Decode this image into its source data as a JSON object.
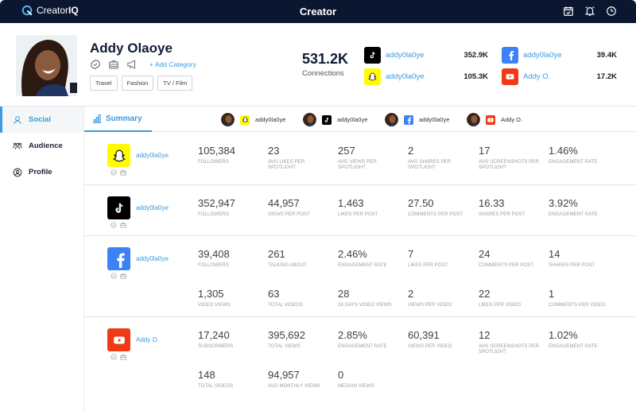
{
  "topbar": {
    "brand_prefix": "Creator",
    "brand_suffix": "IQ",
    "title": "Creator",
    "icons": [
      "calendar-check-icon",
      "bell-icon",
      "clock-icon"
    ]
  },
  "profile": {
    "name": "Addy Olaoye",
    "add_category": "+ Add Category",
    "tags": [
      "Travel",
      "Fashion",
      "TV / Film"
    ],
    "connections_total": "531.2K",
    "connections_label": "Connections",
    "accounts": [
      {
        "platform": "tiktok",
        "handle": "addy0la0ye",
        "count": "352.9K"
      },
      {
        "platform": "snapchat",
        "handle": "addy0la0ye",
        "count": "105.3K"
      },
      {
        "platform": "facebook",
        "handle": "addy0la0ye",
        "count": "39.4K"
      },
      {
        "platform": "youtube",
        "handle": "Addy O.",
        "count": "17.2K"
      }
    ]
  },
  "colors": {
    "accent": "#3a9be0",
    "navbar": "#0b1630",
    "snapchat": "#fffc00",
    "tiktok": "#000000",
    "facebook": "#3b82f6",
    "youtube": "#f03a17"
  },
  "sidebar": {
    "items": [
      {
        "label": "Social",
        "active": true
      },
      {
        "label": "Audience",
        "active": false
      },
      {
        "label": "Profile",
        "active": false
      }
    ]
  },
  "tabs": {
    "summary": "Summary",
    "accounts": [
      {
        "platform": "snapchat",
        "handle": "addy0la0ye"
      },
      {
        "platform": "tiktok",
        "handle": "addy0la0ye"
      },
      {
        "platform": "facebook",
        "handle": "addy0la0ye"
      },
      {
        "platform": "youtube",
        "handle": "Addy O."
      }
    ]
  },
  "rows": [
    {
      "platform": "snapchat",
      "handle": "addy0la0ye",
      "stats": [
        [
          {
            "value": "105,384",
            "label": "Followers"
          },
          {
            "value": "23",
            "label": "Avg likes per spotlight"
          },
          {
            "value": "257",
            "label": "Avg views per spotlight"
          },
          {
            "value": "2",
            "label": "Avg shares per spotlight"
          },
          {
            "value": "17",
            "label": "Avg screenshots per spotlight"
          },
          {
            "value": "1.46%",
            "label": "Engagement rate"
          }
        ]
      ]
    },
    {
      "platform": "tiktok",
      "handle": "addy0la0ye",
      "stats": [
        [
          {
            "value": "352,947",
            "label": "Followers"
          },
          {
            "value": "44,957",
            "label": "Views per post"
          },
          {
            "value": "1,463",
            "label": "Likes per post"
          },
          {
            "value": "27.50",
            "label": "Comments per post"
          },
          {
            "value": "16.33",
            "label": "Shares per post"
          },
          {
            "value": "3.92%",
            "label": "Engagement rate"
          }
        ]
      ]
    },
    {
      "platform": "facebook",
      "handle": "addy0la0ye",
      "stats": [
        [
          {
            "value": "39,408",
            "label": "Followers"
          },
          {
            "value": "261",
            "label": "Talking about"
          },
          {
            "value": "2.46%",
            "label": "Engagement rate"
          },
          {
            "value": "7",
            "label": "Likes per post"
          },
          {
            "value": "24",
            "label": "Comments per post"
          },
          {
            "value": "14",
            "label": "Shares per post"
          }
        ],
        [
          {
            "value": "1,305",
            "label": "Video views"
          },
          {
            "value": "63",
            "label": "Total videos"
          },
          {
            "value": "28",
            "label": "28 days video views"
          },
          {
            "value": "2",
            "label": "Views per video"
          },
          {
            "value": "22",
            "label": "Likes per video"
          },
          {
            "value": "1",
            "label": "Comments per video"
          }
        ]
      ]
    },
    {
      "platform": "youtube",
      "handle": "Addy O.",
      "stats": [
        [
          {
            "value": "17,240",
            "label": "Subscribers"
          },
          {
            "value": "395,692",
            "label": "Total views"
          },
          {
            "value": "2.85%",
            "label": "Engagement rate"
          },
          {
            "value": "60,391",
            "label": "Views per video"
          },
          {
            "value": "12",
            "label": "Avg screenshots per spotlight"
          },
          {
            "value": "1.02%",
            "label": "Engagement rate"
          }
        ],
        [
          {
            "value": "148",
            "label": "Total videos"
          },
          {
            "value": "94,957",
            "label": "Avg monthly views"
          },
          {
            "value": "0",
            "label": "Median views"
          }
        ]
      ]
    }
  ]
}
